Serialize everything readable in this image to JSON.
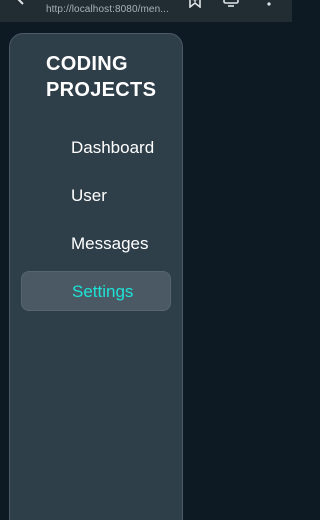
{
  "browser": {
    "url": "http://localhost:8080/men...",
    "icons": [
      "back-arrow-icon",
      "bookmark-icon",
      "mirror-icon",
      "more-vert-icon"
    ]
  },
  "sidebar": {
    "brand_line1": "CODING",
    "brand_line2": "PROJECTS",
    "items": [
      {
        "label": "Dashboard",
        "active": false
      },
      {
        "label": "User",
        "active": false
      },
      {
        "label": "Messages",
        "active": false
      },
      {
        "label": "Settings",
        "active": true
      }
    ]
  },
  "colors": {
    "page_background": "#0d1a23",
    "sidebar_background": "#2f3f4a",
    "active_item_background": "#4a5963",
    "active_text": "#1ee3d7",
    "text": "#ffffff"
  }
}
